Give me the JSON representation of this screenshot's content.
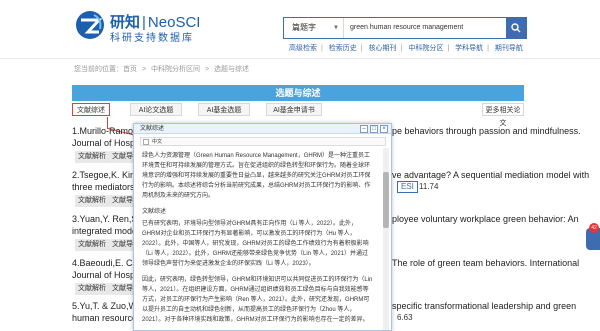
{
  "header": {
    "brand_cn": "研知",
    "brand_en": "NeoSCI",
    "brand_sub": "科研支持数据库",
    "search_select": "篇题字",
    "search_value": "green human resource management",
    "links": [
      "高级检索",
      "检索历史",
      "核心期刊",
      "中科院分区",
      "学科导航",
      "期刊导航"
    ]
  },
  "breadcrumbs": [
    "您当前的位置：首页",
    ">",
    "中科院分析区间",
    ">",
    "选题与综述"
  ],
  "banner": "选题与综述",
  "tabs": [
    "文献综述",
    "AI论文选题",
    "AI基金选题",
    "AI基金申请书",
    "更多相关论文"
  ],
  "results": [
    {
      "left": "1.Murillo-Ramos,L. & M",
      "right": "pe behaviors through passion and mindfulness.",
      "line2": "Journal of Hospitality Ma"
    },
    {
      "left": "2.Tsegoe,K. Kim,G. & H",
      "right": "ve advantage? A sequential mediation model with",
      "line2": "three mediators. Internat",
      "esi": "ESI",
      "esi_value": "11.74"
    },
    {
      "left": "3.Yuan,Y. Ren,S. Tang,C",
      "right": "ployee voluntary workplace green behavior: An",
      "line2": "integrated model. Journa"
    },
    {
      "left": "4.Baeoudi,E. Cai,W. & Ji",
      "right": "The role of green team behaviors. International",
      "line2": "Journal of Hospitality Ma"
    },
    {
      "left": "5.Yu,T. & Zuo,W. (2022)",
      "right": "specific transformational leadership and green",
      "line2": "human resource manage",
      "right2": "6.63"
    }
  ],
  "result_buttons": [
    "文献解析",
    "文献导读"
  ],
  "popup": {
    "title": "文献综述",
    "toolbar_label": "中文",
    "paragraphs": [
      "绿色人力资源管理（Green Human Resource Management，GHRM）是一种注重员工环境责任和可持续发展的管理方式。旨在促进组织的绿色转型和环保行为。随着全球环境意识的增强和可持续发展的重要性日益凸显，越来越多的研究关注GHRM对员工环保行为的影响。本综述将综合分析当前研究成果，总结GHRM对员工环保行为的影响、作用机制及未来的研究方向。",
      "文献综述",
      "已有研究表明，环境导向型领导对GHRM具有正向作用（Li 等人，2022）。此外，GHRM对企业和员工环保行为有显著影响，可以激发员工的环保行为（Hu 等人，2022）。此外，中国等人，研究发现，GHRM对员工的绿色工作绩效行为有着积极影响（Li 等人，2022）。此外，GHRM还能够带来绿色竞争优势（Lin 等人，2021）并通过领导绿色声誉行为来促进激发企业的环保实践（Li 等人，2023）。",
      "因此，研究表明，绿色转型领导，GHRM和环境知识可以共同促进员工的环保行为（Lin 等人，2021）。在组织建设方面，GHRM通过组织绩效和员工绿色目标与自我效能感等方式，对员工的环保行为产生影响（Ren 等人，2021）。此外，研究还发现，GHRM可以提升员工的自主动机和绿色创新，从而提高员工的绿色环保行为（Zhou 等人，2021）。对于各种环境实践和政策，GHRM对员工环保行为的影响也存在一定的差异。"
    ]
  },
  "notification_count": "42",
  "colors": {
    "brand": "#1c5fae",
    "banner": "#4aa3dd",
    "highlight": "#e04040"
  }
}
